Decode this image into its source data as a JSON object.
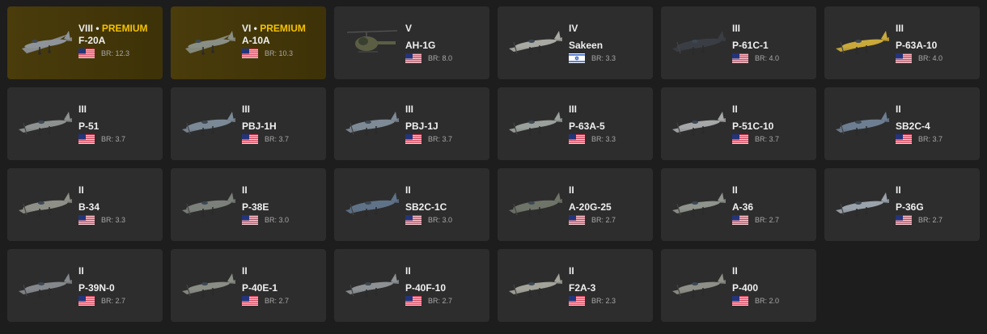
{
  "cards": [
    {
      "rank": "VIII •",
      "premium": "PREMIUM",
      "name": "F-20A",
      "br": "BR: 12.3",
      "country": "usa",
      "icon": "jet-fighter-icon",
      "color": "#8e949a"
    },
    {
      "rank": "VI •",
      "premium": "PREMIUM",
      "name": "A-10A",
      "br": "BR: 10.3",
      "country": "usa",
      "icon": "attack-jet-icon",
      "color": "#8a8f86"
    },
    {
      "rank": "V",
      "premium": "",
      "name": "AH-1G",
      "br": "BR: 8.0",
      "country": "usa",
      "icon": "helicopter-icon",
      "color": "#5c5e44"
    },
    {
      "rank": "IV",
      "premium": "",
      "name": "Sakeen",
      "br": "BR: 3.3",
      "country": "israel",
      "icon": "prop-fighter-icon",
      "color": "#a9a9a4"
    },
    {
      "rank": "III",
      "premium": "",
      "name": "P-61C-1",
      "br": "BR: 4.0",
      "country": "usa",
      "icon": "night-fighter-icon",
      "color": "#3a3e44"
    },
    {
      "rank": "III",
      "premium": "",
      "name": "P-63A-10",
      "br": "BR: 4.0",
      "country": "usa",
      "icon": "prop-fighter-icon",
      "color": "#c9a93a"
    },
    {
      "rank": "III",
      "premium": "",
      "name": "P-51",
      "br": "BR: 3.7",
      "country": "usa",
      "icon": "prop-fighter-icon",
      "color": "#8d9190"
    },
    {
      "rank": "III",
      "premium": "",
      "name": "PBJ-1H",
      "br": "BR: 3.7",
      "country": "usa",
      "icon": "bomber-icon",
      "color": "#7b8896"
    },
    {
      "rank": "III",
      "premium": "",
      "name": "PBJ-1J",
      "br": "BR: 3.7",
      "country": "usa",
      "icon": "bomber-icon",
      "color": "#7e8a96"
    },
    {
      "rank": "III",
      "premium": "",
      "name": "P-63A-5",
      "br": "BR: 3.3",
      "country": "usa",
      "icon": "prop-fighter-icon",
      "color": "#9aa09c"
    },
    {
      "rank": "II",
      "premium": "",
      "name": "P-51C-10",
      "br": "BR: 3.7",
      "country": "usa",
      "icon": "prop-fighter-icon",
      "color": "#a5a7a8"
    },
    {
      "rank": "II",
      "premium": "",
      "name": "SB2C-4",
      "br": "BR: 3.7",
      "country": "usa",
      "icon": "dive-bomber-icon",
      "color": "#6d7e92"
    },
    {
      "rank": "II",
      "premium": "",
      "name": "B-34",
      "br": "BR: 3.3",
      "country": "usa",
      "icon": "bomber-icon",
      "color": "#8e9088"
    },
    {
      "rank": "II",
      "premium": "",
      "name": "P-38E",
      "br": "BR: 3.0",
      "country": "usa",
      "icon": "twin-boom-fighter-icon",
      "color": "#7c807a"
    },
    {
      "rank": "II",
      "premium": "",
      "name": "SB2C-1C",
      "br": "BR: 3.0",
      "country": "usa",
      "icon": "dive-bomber-icon",
      "color": "#5f7288"
    },
    {
      "rank": "II",
      "premium": "",
      "name": "A-20G-25",
      "br": "BR: 2.7",
      "country": "usa",
      "icon": "attack-bomber-icon",
      "color": "#6f7468"
    },
    {
      "rank": "II",
      "premium": "",
      "name": "A-36",
      "br": "BR: 2.7",
      "country": "usa",
      "icon": "prop-fighter-icon",
      "color": "#8f948c"
    },
    {
      "rank": "II",
      "premium": "",
      "name": "P-36G",
      "br": "BR: 2.7",
      "country": "usa",
      "icon": "prop-fighter-icon",
      "color": "#9aa3ab"
    },
    {
      "rank": "II",
      "premium": "",
      "name": "P-39N-0",
      "br": "BR: 2.7",
      "country": "usa",
      "icon": "prop-fighter-icon",
      "color": "#84888c"
    },
    {
      "rank": "II",
      "premium": "",
      "name": "P-40E-1",
      "br": "BR: 2.7",
      "country": "usa",
      "icon": "prop-fighter-icon",
      "color": "#8a8d84"
    },
    {
      "rank": "II",
      "premium": "",
      "name": "P-40F-10",
      "br": "BR: 2.7",
      "country": "usa",
      "icon": "prop-fighter-icon",
      "color": "#8d9194"
    },
    {
      "rank": "II",
      "premium": "",
      "name": "F2A-3",
      "br": "BR: 2.3",
      "country": "usa",
      "icon": "prop-fighter-icon",
      "color": "#a3a39a"
    },
    {
      "rank": "II",
      "premium": "",
      "name": "P-400",
      "br": "BR: 2.0",
      "country": "usa",
      "icon": "prop-fighter-icon",
      "color": "#8e9088"
    }
  ],
  "colors": {
    "premium": "#f5c300",
    "card_bg": "#2d2d2d",
    "page_bg": "#1d1d1d"
  }
}
